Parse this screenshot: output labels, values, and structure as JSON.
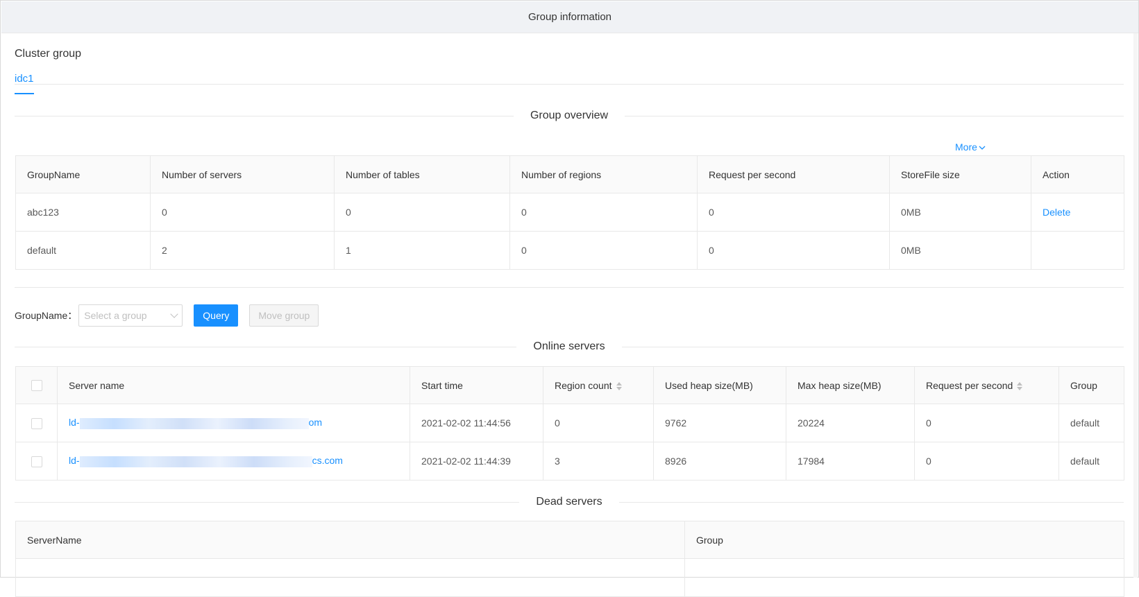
{
  "header": {
    "title": "Group information"
  },
  "cluster": {
    "title": "Cluster group",
    "tabs": [
      {
        "label": "idc1",
        "active": true
      }
    ]
  },
  "overview": {
    "title": "Group overview",
    "more_label": "More",
    "columns": [
      "GroupName",
      "Number of servers",
      "Number of tables",
      "Number of regions",
      "Request per second",
      "StoreFile size",
      "Action"
    ],
    "rows": [
      {
        "group": "abc123",
        "servers": "0",
        "tables": "0",
        "regions": "0",
        "rps": "0",
        "storefile": "0MB",
        "action": "Delete"
      },
      {
        "group": "default",
        "servers": "2",
        "tables": "1",
        "regions": "0",
        "rps": "0",
        "storefile": "0MB",
        "action": ""
      }
    ]
  },
  "filter": {
    "label": "GroupName：",
    "select_placeholder": "Select a group",
    "query_label": "Query",
    "move_label": "Move group"
  },
  "online": {
    "title": "Online servers",
    "columns": [
      "Server name",
      "Start time",
      "Region count",
      "Used heap size(MB)",
      "Max heap size(MB)",
      "Request per second",
      "Group"
    ],
    "rows": [
      {
        "name_prefix": "ld-",
        "name_suffix": "om",
        "start": "2021-02-02 11:44:56",
        "regions": "0",
        "used": "9762",
        "max": "20224",
        "rps": "0",
        "group": "default"
      },
      {
        "name_prefix": "ld-",
        "name_suffix": "cs.com",
        "start": "2021-02-02 11:44:39",
        "regions": "3",
        "used": "8926",
        "max": "17984",
        "rps": "0",
        "group": "default"
      }
    ]
  },
  "dead": {
    "title": "Dead servers",
    "columns": [
      "ServerName",
      "Group"
    ]
  },
  "colors": {
    "primary": "#1890ff",
    "header_bg": "#f0f2f5",
    "border": "#e8e8e8"
  }
}
